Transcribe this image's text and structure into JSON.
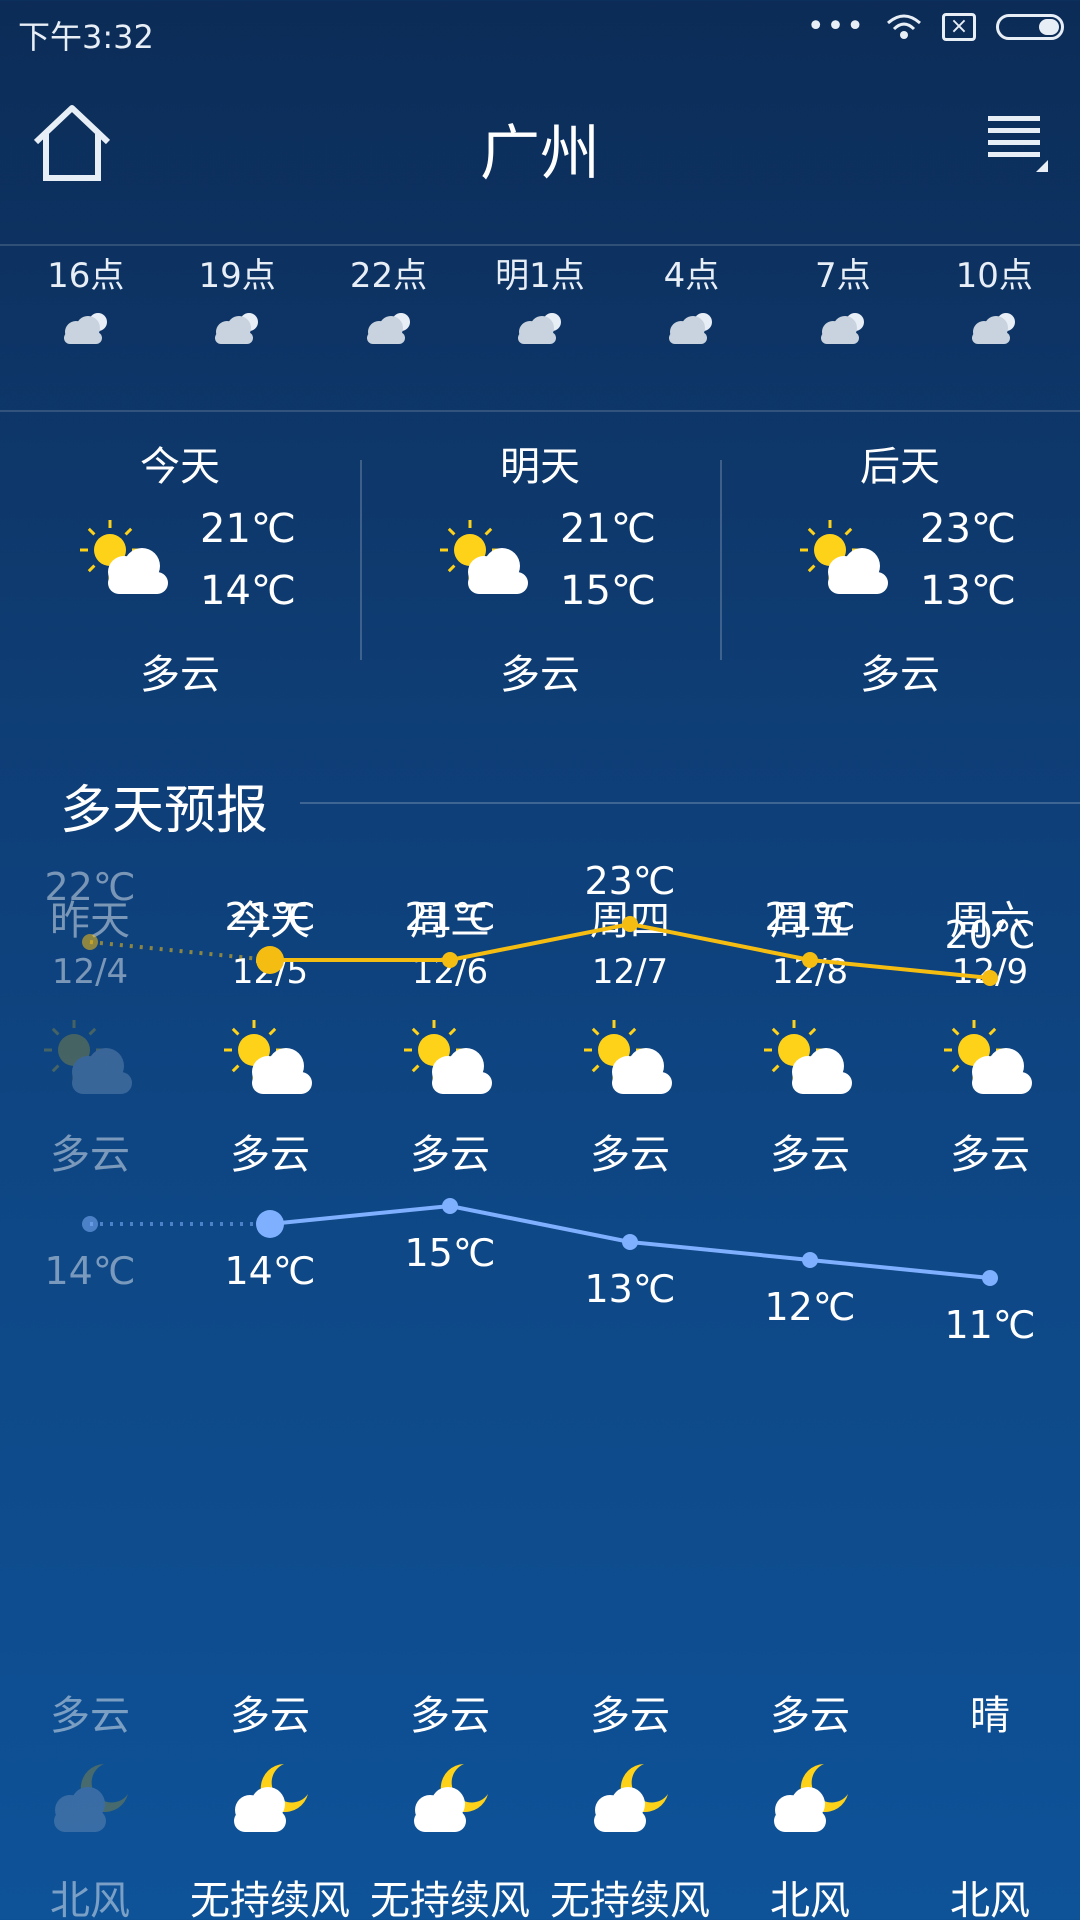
{
  "status_bar": {
    "time": "下午3:32",
    "dots": "•••",
    "icons": [
      "signal-dots-icon",
      "wifi-icon",
      "sim-x-icon",
      "battery-icon"
    ]
  },
  "header": {
    "city": "广州",
    "home_icon": "home-icon",
    "menu_icon": "menu-icon"
  },
  "hourly": [
    {
      "time": "16点",
      "icon": "cloudy-icon"
    },
    {
      "time": "19点",
      "icon": "cloudy-icon"
    },
    {
      "time": "22点",
      "icon": "cloudy-icon"
    },
    {
      "time": "明1点",
      "icon": "cloudy-icon"
    },
    {
      "time": "4点",
      "icon": "cloudy-icon"
    },
    {
      "time": "7点",
      "icon": "cloudy-icon"
    },
    {
      "time": "10点",
      "icon": "cloudy-icon"
    }
  ],
  "three_day": [
    {
      "name": "今天",
      "high": "21℃",
      "low": "14℃",
      "condition": "多云",
      "icon": "partly-cloudy-icon"
    },
    {
      "name": "明天",
      "high": "21℃",
      "low": "15℃",
      "condition": "多云",
      "icon": "partly-cloudy-icon"
    },
    {
      "name": "后天",
      "high": "23℃",
      "low": "13℃",
      "condition": "多云",
      "icon": "partly-cloudy-icon"
    }
  ],
  "forecast": {
    "title": "多天预报",
    "days": [
      {
        "day": "昨天",
        "date": "12/4",
        "day_condition": "多云",
        "night_condition": "多云",
        "wind": "北风",
        "past": true,
        "night_icon": "cloudy-night-icon"
      },
      {
        "day": "今天",
        "date": "12/5",
        "day_condition": "多云",
        "night_condition": "多云",
        "wind": "无持续风",
        "past": false,
        "night_icon": "cloudy-night-icon"
      },
      {
        "day": "周三",
        "date": "12/6",
        "day_condition": "多云",
        "night_condition": "多云",
        "wind": "无持续风",
        "past": false,
        "night_icon": "cloudy-night-icon"
      },
      {
        "day": "周四",
        "date": "12/7",
        "day_condition": "多云",
        "night_condition": "多云",
        "wind": "无持续风",
        "past": false,
        "night_icon": "cloudy-night-icon"
      },
      {
        "day": "周五",
        "date": "12/8",
        "day_condition": "多云",
        "night_condition": "多云",
        "wind": "北风",
        "past": false,
        "night_icon": "cloudy-night-icon"
      },
      {
        "day": "周六",
        "date": "12/9",
        "day_condition": "多云",
        "night_condition": "晴",
        "wind": "北风",
        "past": false,
        "night_icon": "moon-icon"
      }
    ]
  },
  "colors": {
    "high_line": "#f5bd12",
    "low_line": "#7fb0ff",
    "sun": "#ffd21a"
  },
  "chart_data": {
    "type": "line",
    "categories": [
      "12/4",
      "12/5",
      "12/6",
      "12/7",
      "12/8",
      "12/9"
    ],
    "series": [
      {
        "values": [
          22,
          21,
          21,
          23,
          21,
          20
        ]
      },
      {
        "values": [
          14,
          14,
          15,
          13,
          12,
          11
        ]
      }
    ],
    "high_labels": [
      "22℃",
      "21℃",
      "21℃",
      "23℃",
      "21℃",
      "20℃"
    ],
    "low_labels": [
      "14℃",
      "14℃",
      "15℃",
      "13℃",
      "12℃",
      "11℃"
    ]
  }
}
